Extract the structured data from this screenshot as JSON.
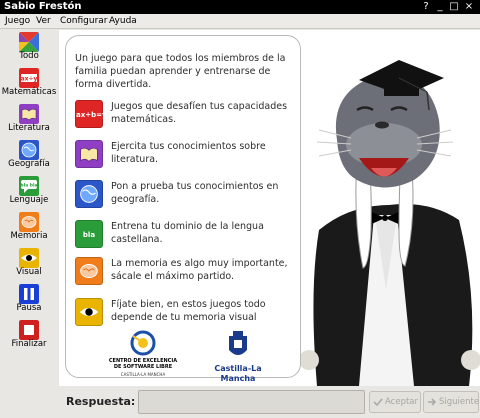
{
  "window": {
    "title": "Sabio Frestón",
    "buttons": [
      "?",
      "_",
      "□",
      "×"
    ]
  },
  "menubar": {
    "items": [
      "Juego",
      "Ver",
      "Configurar",
      "Ayuda"
    ]
  },
  "sidebar": {
    "items": [
      {
        "label": "Todo",
        "icon": "all-games-icon"
      },
      {
        "label": "Matemáticas",
        "icon": "math-icon",
        "icon_text": "ax÷y"
      },
      {
        "label": "Literatura",
        "icon": "book-icon"
      },
      {
        "label": "Geografía",
        "icon": "globe-icon"
      },
      {
        "label": "Lenguaje",
        "icon": "speech-bubble-icon",
        "icon_text": "bla bla"
      },
      {
        "label": "Memoria",
        "icon": "brain-icon"
      },
      {
        "label": "Visual",
        "icon": "eye-icon"
      },
      {
        "label": "Pausa",
        "icon": "pause-icon"
      },
      {
        "label": "Finalizar",
        "icon": "stop-icon"
      }
    ]
  },
  "main": {
    "intro": "Un juego para que todos los miembros de la familia puedan aprender y entrenarse de forma divertida.",
    "entries": [
      {
        "icon": "math-icon",
        "icon_text": "ax÷b=y",
        "text": "Juegos que desafíen tus capacidades matemáticas."
      },
      {
        "icon": "book-icon",
        "text": "Ejercita tus conocimientos sobre literatura."
      },
      {
        "icon": "globe-icon",
        "text": "Pon a prueba tus conocimientos en geografía."
      },
      {
        "icon": "speech-bubble-icon",
        "icon_text": "bla bla",
        "text": "Entrena tu dominio de la lengua castellana."
      },
      {
        "icon": "brain-icon",
        "text": "La memoria es algo muy importante, sácale el máximo partido."
      },
      {
        "icon": "eye-icon",
        "text": "Fíjate bien, en estos juegos todo depende de tu memoria visual"
      }
    ],
    "logos": {
      "cesl_line1": "CENTRO DE EXCELENCIA",
      "cesl_line2": "DE SOFTWARE LIBRE",
      "cesl_line3": "CASTILLA-LA MANCHA",
      "clm": "Castilla-La Mancha"
    }
  },
  "answer": {
    "label": "Respuesta:",
    "value": "",
    "accept_label": "Aceptar",
    "next_label": "Siguiente"
  }
}
